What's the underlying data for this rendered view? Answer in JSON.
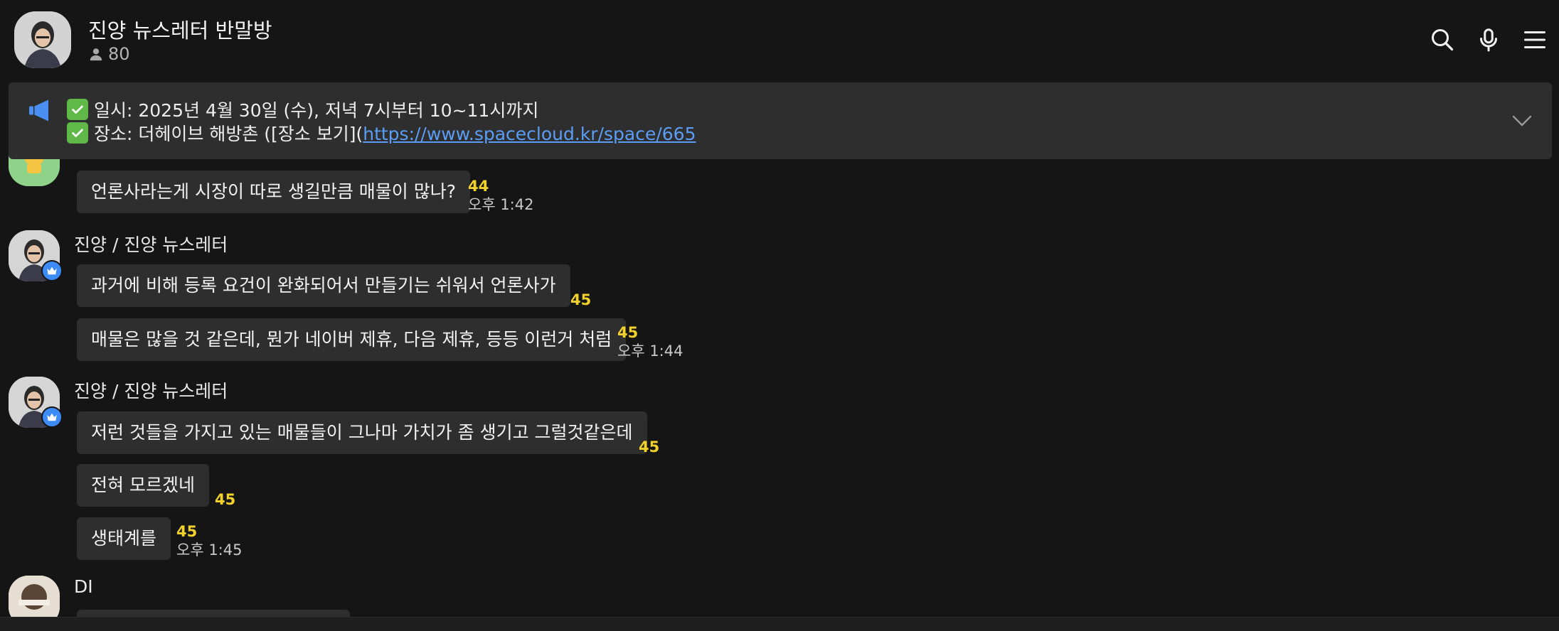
{
  "header": {
    "title": "진양 뉴스레터 반말방",
    "member_count": "80"
  },
  "notice": {
    "line1_text": "일시: 2025년 4월 30일 (수), 저녁 7시부터 10~11시까지",
    "line2_text": "장소: 더헤이브 해방촌 ([장소 보기](",
    "line2_link": "https://www.spacecloud.kr/space/665"
  },
  "messages": {
    "m0": {
      "text": "언론사라는게 시장이 따로 생길만큼 매물이 많나?",
      "count": "44",
      "time": "오후 1:42"
    },
    "g1": {
      "sender": "진양 / 진양 뉴스레터",
      "m1": {
        "text": "과거에 비해 등록 요건이 완화되어서 만들기는 쉬워서 언론사가",
        "count": "45"
      },
      "m2": {
        "text": "매물은 많을 것 같은데, 뭔가 네이버 제휴, 다음 제휴, 등등 이런거 처럼",
        "count": "45",
        "time": "오후 1:44"
      }
    },
    "g2": {
      "sender": "진양 / 진양 뉴스레터",
      "m1": {
        "text": "저런 것들을 가지고 있는 매물들이 그나마 가치가 좀 생기고 그럴것같은데",
        "count": "45"
      },
      "m2": {
        "text": "전혀 모르겠네",
        "count": "45"
      },
      "m3": {
        "text": "생태계를",
        "count": "45",
        "time": "오후 1:45"
      }
    },
    "g3": {
      "sender": "DI"
    }
  },
  "colors": {
    "background": "#151515",
    "bubble": "#2e2e2e",
    "unread_count": "#f2d12a",
    "link": "#5b9df5",
    "crown_badge": "#3d8bf7",
    "check": "#5fb847"
  },
  "icons": {
    "search": "search-icon",
    "mic": "microphone-icon",
    "menu": "menu-icon",
    "notice": "megaphone-icon",
    "expand": "chevron-down-icon",
    "host": "crown-icon"
  }
}
